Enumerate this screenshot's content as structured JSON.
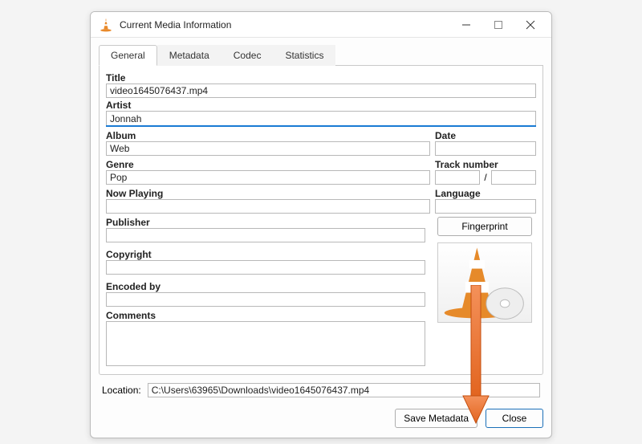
{
  "window": {
    "title": "Current Media Information"
  },
  "tabs": {
    "general": "General",
    "metadata": "Metadata",
    "codec": "Codec",
    "statistics": "Statistics"
  },
  "labels": {
    "title": "Title",
    "artist": "Artist",
    "album": "Album",
    "date": "Date",
    "genre": "Genre",
    "track_number": "Track number",
    "now_playing": "Now Playing",
    "language": "Language",
    "publisher": "Publisher",
    "copyright": "Copyright",
    "encoded_by": "Encoded by",
    "comments": "Comments",
    "location": "Location:",
    "track_sep": "/"
  },
  "values": {
    "title": "video1645076437.mp4",
    "artist": "Jonnah",
    "album": "Web",
    "date": "",
    "genre": "Pop",
    "track_num": "",
    "track_total": "",
    "now_playing": "",
    "language": "",
    "publisher": "",
    "copyright": "",
    "encoded_by": "",
    "comments": "",
    "location": "C:\\Users\\63965\\Downloads\\video1645076437.mp4"
  },
  "buttons": {
    "fingerprint": "Fingerprint",
    "save_metadata": "Save Metadata",
    "close": "Close"
  },
  "icons": {
    "app": "vlc-cone-icon",
    "minimize": "minimize-icon",
    "maximize": "maximize-icon",
    "close": "close-icon"
  }
}
